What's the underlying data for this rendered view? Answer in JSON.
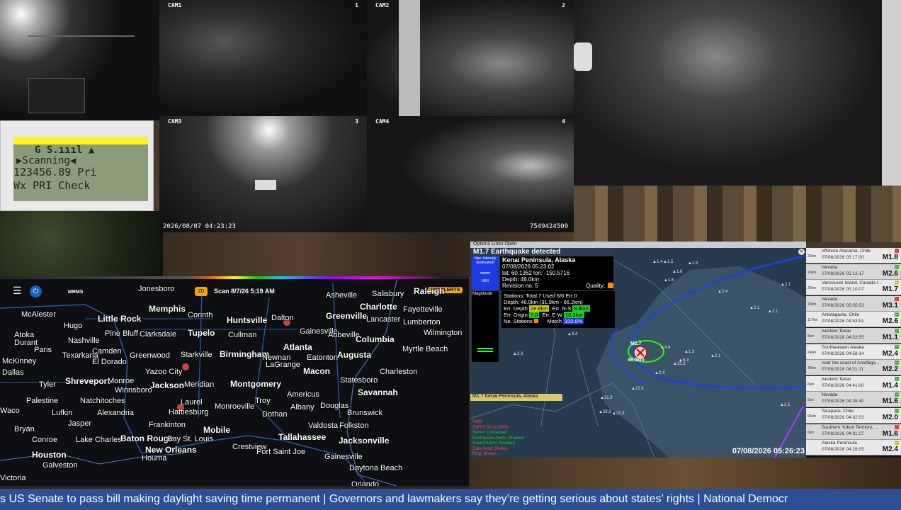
{
  "cams": {
    "c1": "CAM1",
    "c1n": "1",
    "c2": "CAM2",
    "c2n": "2",
    "c3": "CAM3",
    "c3n": "3",
    "c4": "CAM4",
    "c4n": "4",
    "timestamp": "2026/08/07 04:23:23",
    "serial": "7549424509"
  },
  "scanner": {
    "line1": "G   S.ıııl   ▲",
    "line2": "▶Scanning◀",
    "line3": "123456.89  Pri",
    "line4": "Wx PRI Check"
  },
  "weather": {
    "brand": "MRMS",
    "zoom": "2D",
    "scan": "Scan  8/7/26 5:19 AM",
    "alerts": "192 ALERTS",
    "cities": [
      "Jonesboro",
      "Memphis",
      "Corinth",
      "Huntsville",
      "Asheville",
      "Salisbury",
      "Raleigh",
      "McAlester",
      "Little Rock",
      "Tupelo",
      "Dalton",
      "Greenville",
      "Charlotte",
      "Fayetteville",
      "Nashville",
      "Pine Bluff",
      "Clarksdale",
      "Cullman",
      "Gainesville",
      "Lancaster",
      "Lumberton",
      "Atoka",
      "Durant",
      "Hugo",
      "Paris",
      "Camden",
      "Greenwood",
      "Starkville",
      "Birmingham",
      "Atlanta",
      "Abbeville",
      "Columbia",
      "Wilmington",
      "Texarkana",
      "El Dorado",
      "Newnan",
      "Eatonton",
      "Augusta",
      "Myrtle Beach",
      "McKinney",
      "Yazoo City",
      "LaGrange",
      "Macon",
      "Charleston",
      "Dallas",
      "Tyler",
      "Shreveport",
      "Monroe",
      "Jackson",
      "Meridian",
      "Montgomery",
      "Statesboro",
      "Winnsboro",
      "Savannah",
      "Palestine",
      "Natchitoches",
      "Laurel",
      "Troy",
      "Americus",
      "Lufkin",
      "Alexandria",
      "Hattiesburg",
      "Monroeville",
      "Dothan",
      "Albany",
      "Douglas",
      "Brunswick",
      "Jasper",
      "Frankinton",
      "Valdosta",
      "Folkston",
      "Waco",
      "Bryan",
      "Conroe",
      "Lake Charles",
      "Baton Rouge",
      "Mobile",
      "Crestview",
      "Tallahassee",
      "Jacksonville",
      "Bay St. Louis",
      "New Orleans",
      "Houston",
      "Houma",
      "Port Saint Joe",
      "Gainesville",
      "Galveston",
      "Daytona Beach",
      "Victoria",
      "Orlando"
    ]
  },
  "quake": {
    "menu": "Options   Links   Open",
    "title": "M1.7 Earthquake detected",
    "mmi_label": "Max. Intensity (Estimated)",
    "mmi_value": "—",
    "mmi_unit": "MMI",
    "place": "Kenai Peninsula, Alaska",
    "time": "07/08/2026 05:23:02",
    "coords": "lat: 60.1362 lon: -150.5716",
    "depth": "Depth: 46.0km",
    "revision": "Revision no. 5",
    "quality": "Quality:",
    "magnitude_label": "Magnitude",
    "stations": "Stations: Total 7 Used 6/6 Err 0",
    "depth_detail": "Depth: 46.0km (31.9km - 66.2km)",
    "err_depth": "Err. Depth",
    "err_depth_v": "24.8km",
    "err_ns": "Err. N-S",
    "err_ns_v": "8.8km",
    "err_origin": "Err. Origin",
    "err_origin_v": "7.0",
    "err_ew": "Err. E-W",
    "err_ew_v": "10.3km",
    "no_stations": "No. Stations",
    "match": "Match",
    "match_v": "100.0%",
    "quake_label": "M1.7",
    "quake_depth": "46.0km",
    "banner": "M1.7 Kenai Peninsula, Alaska",
    "foot1": "RMS",
    "foot2": "GMT 0.00 (1.0000)",
    "foot3": "Server Connected",
    "foot4": "Earthquake Alerts: Enabled",
    "foot5": "Sound Alarm: Enabled",
    "foot6": "Data Feed: Shown",
    "foot7": "Ping: Shown",
    "clock": "07/08/2026 05:26:23",
    "station_vals": [
      "1.5",
      "1.6",
      "1.4",
      "1.8",
      "2.4",
      "2.1",
      "2.1",
      "2.1",
      "1.6",
      "4.4",
      "5.3",
      "2.4",
      "2.1",
      "15.3",
      "1.3",
      "22.3",
      "21.3",
      "4.4",
      "2.3",
      "22.3",
      "23.3",
      "2.5"
    ]
  },
  "quakelist": [
    {
      "loc": "offshore Atacama, Chile",
      "date": "07/08/2026 05:17:00",
      "mag": "M1.8",
      "km": "25km",
      "color": "#ff3333"
    },
    {
      "loc": "Nevada",
      "date": "07/08/2026 05:13:17",
      "mag": "M2.6",
      "km": "10km",
      "color": "#33cc33"
    },
    {
      "loc": "Vancouver Island, Canada r...",
      "date": "07/08/2026 05:10:07",
      "mag": "M1.7",
      "km": "30km",
      "color": "#cccc33"
    },
    {
      "loc": "Nevada",
      "date": "07/08/2026 05:05:53",
      "mag": "M3.1",
      "km": "10km",
      "color": "#ff3333"
    },
    {
      "loc": "Antofagasta, Chile",
      "date": "07/08/2026 04:53:51",
      "mag": "M2.6",
      "km": "117km",
      "color": "#33cc33"
    },
    {
      "loc": "western Texas",
      "date": "07/08/2026 04:53:55",
      "mag": "M1.1",
      "km": "5km",
      "color": "#33cc33"
    },
    {
      "loc": "Southeastern Alaska",
      "date": "07/08/2026 04:58:14",
      "mag": "M2.4",
      "km": "24km",
      "color": "#33cc33"
    },
    {
      "loc": "near the coast of Antofaga...",
      "date": "07/08/2026 04:51:11",
      "mag": "M2.2",
      "km": "40km",
      "color": "#33cc33"
    },
    {
      "loc": "western Texas",
      "date": "07/08/2026 04:41:00",
      "mag": "M1.4",
      "km": "6km",
      "color": "#33cc33"
    },
    {
      "loc": "Nevada",
      "date": "07/08/2026 04:35:40",
      "mag": "M1.6",
      "km": "5km",
      "color": "#33cc33"
    },
    {
      "loc": "Tarapaca, Chile",
      "date": "07/08/2026 04:32:03",
      "mag": "M2.0",
      "km": "96km",
      "color": "#33cc33"
    },
    {
      "loc": "Southern Yukon Territory, ...",
      "date": "07/08/2026 04:31:27",
      "mag": "M1.6",
      "km": "6km",
      "color": "#ff3333"
    },
    {
      "loc": "Alaska Peninsula",
      "date": "07/08/2026 04:28:05",
      "mag": "M2.4",
      "km": "",
      "color": "#cccc33"
    }
  ],
  "ticker": "s US Senate to pass bill making daylight saving time permanent  |  Governors and lawmakers say they’re getting serious about states’ rights  |  National Democr"
}
